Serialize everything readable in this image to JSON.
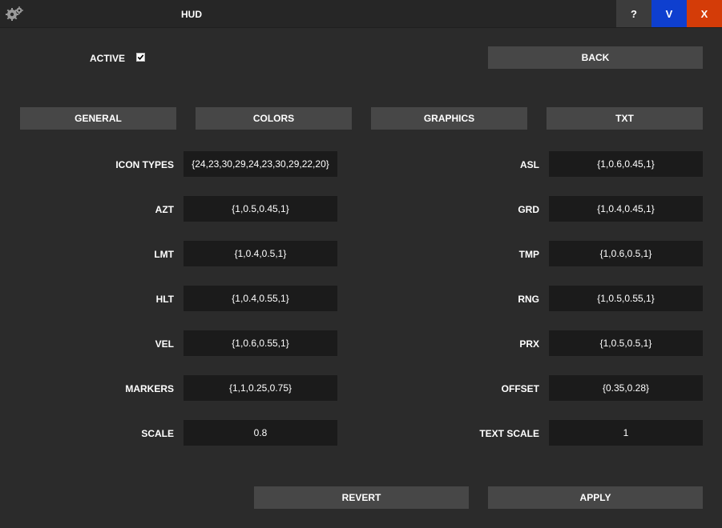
{
  "window": {
    "title": "HUD",
    "help_label": "?",
    "v_label": "V",
    "close_label": "X"
  },
  "active": {
    "label": "ACTIVE",
    "checked": true
  },
  "back_label": "BACK",
  "tabs": [
    "GENERAL",
    "COLORS",
    "GRAPHICS",
    "TXT"
  ],
  "left_fields": [
    {
      "label": "ICON TYPES",
      "value": "{24,23,30,29,24,23,30,29,22,20}"
    },
    {
      "label": "AZT",
      "value": "{1,0.5,0.45,1}"
    },
    {
      "label": "LMT",
      "value": "{1,0.4,0.5,1}"
    },
    {
      "label": "HLT",
      "value": "{1,0.4,0.55,1}"
    },
    {
      "label": "VEL",
      "value": "{1,0.6,0.55,1}"
    },
    {
      "label": "MARKERS",
      "value": "{1,1,0.25,0.75}"
    },
    {
      "label": "SCALE",
      "value": "0.8"
    }
  ],
  "right_fields": [
    {
      "label": "ASL",
      "value": "{1,0.6,0.45,1}"
    },
    {
      "label": "GRD",
      "value": "{1,0.4,0.45,1}"
    },
    {
      "label": "TMP",
      "value": "{1,0.6,0.5,1}"
    },
    {
      "label": "RNG",
      "value": "{1,0.5,0.55,1}"
    },
    {
      "label": "PRX",
      "value": "{1,0.5,0.5,1}"
    },
    {
      "label": "OFFSET",
      "value": "{0.35,0.28}"
    },
    {
      "label": "TEXT SCALE",
      "value": "1"
    }
  ],
  "footer": {
    "revert_label": "REVERT",
    "apply_label": "APPLY"
  },
  "colors": {
    "background": "#2b2b2b",
    "button": "#474747",
    "field": "#1b1b1b",
    "v_button": "#0e3fcf",
    "close_button": "#d43c08"
  }
}
